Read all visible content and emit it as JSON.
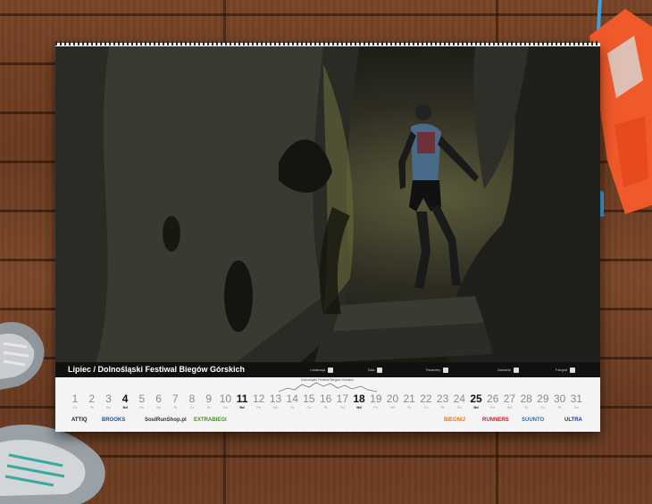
{
  "caption": "Lipiec / Dolnośląski Festiwal Biegów Górskich",
  "info": [
    "Lokalizacja",
    "Data",
    "Parametry",
    "Zawodnik",
    "Fotograf"
  ],
  "profile_label": "Dolnośląski Festiwal Biegów Górskich",
  "days": [
    {
      "n": "1",
      "w": "Cz"
    },
    {
      "n": "2",
      "w": "Pt"
    },
    {
      "n": "3",
      "w": "So"
    },
    {
      "n": "4",
      "w": "Nd",
      "sun": true
    },
    {
      "n": "5",
      "w": "Pn"
    },
    {
      "n": "6",
      "w": "Wt"
    },
    {
      "n": "7",
      "w": "Śr"
    },
    {
      "n": "8",
      "w": "Cz"
    },
    {
      "n": "9",
      "w": "Pt"
    },
    {
      "n": "10",
      "w": "So"
    },
    {
      "n": "11",
      "w": "Nd",
      "sun": true
    },
    {
      "n": "12",
      "w": "Pn"
    },
    {
      "n": "13",
      "w": "Wt"
    },
    {
      "n": "14",
      "w": "Śr"
    },
    {
      "n": "15",
      "w": "Cz"
    },
    {
      "n": "16",
      "w": "Pt"
    },
    {
      "n": "17",
      "w": "So"
    },
    {
      "n": "18",
      "w": "Nd",
      "sun": true
    },
    {
      "n": "19",
      "w": "Pn"
    },
    {
      "n": "20",
      "w": "Wt"
    },
    {
      "n": "21",
      "w": "Śr"
    },
    {
      "n": "22",
      "w": "Cz"
    },
    {
      "n": "23",
      "w": "Pt"
    },
    {
      "n": "24",
      "w": "So"
    },
    {
      "n": "25",
      "w": "Nd",
      "sun": true
    },
    {
      "n": "26",
      "w": "Pn"
    },
    {
      "n": "27",
      "w": "Wt"
    },
    {
      "n": "28",
      "w": "Śr"
    },
    {
      "n": "29",
      "w": "Cz"
    },
    {
      "n": "30",
      "w": "Pt"
    },
    {
      "n": "31",
      "w": "So"
    }
  ],
  "logos": [
    {
      "text": "ATTIQ",
      "color": "#222"
    },
    {
      "text": "BROOKS",
      "color": "#1a4fa3"
    },
    {
      "text": "SoulRunShop.pl",
      "color": "#333"
    },
    {
      "text": "EXTRABIEGI",
      "color": "#4a8a2a"
    },
    {
      "text": "BIEGNIJ",
      "color": "#e07a1a"
    },
    {
      "text": "RUNNERS",
      "color": "#c8202a"
    },
    {
      "text": "SUUNTO",
      "color": "#2a6fb0"
    },
    {
      "text": "ULTRA",
      "color": "#1a3a7a"
    }
  ],
  "colors": {
    "wood": "#6b3d22",
    "pack": "#f05a2a",
    "accent": "#111111"
  }
}
